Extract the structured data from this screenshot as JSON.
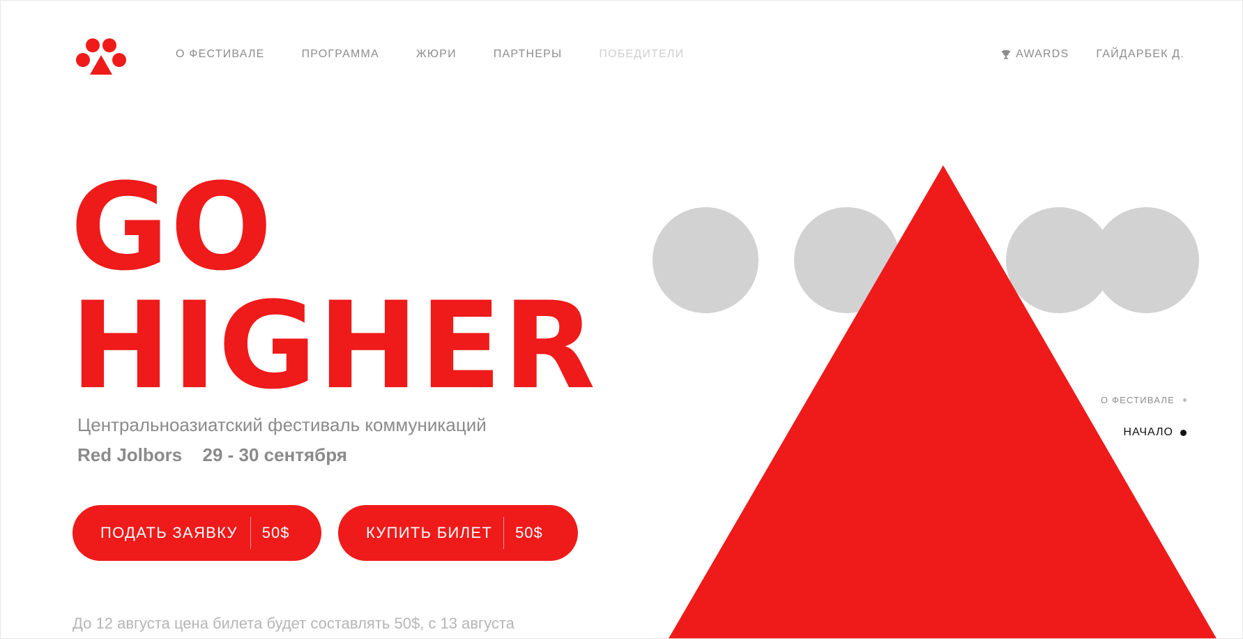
{
  "nav": {
    "items": [
      {
        "label": "О ФЕСТИВАЛЕ"
      },
      {
        "label": "ПРОГРАММА"
      },
      {
        "label": "ЖЮРИ"
      },
      {
        "label": "ПАРТНЕРЫ"
      },
      {
        "label": "ПОБЕДИТЕЛИ"
      }
    ],
    "awards_label": "AWARDS",
    "user_name": "ГАЙДАРБЕК Д."
  },
  "hero": {
    "title_line1": "GO",
    "title_line2": "HIGHER",
    "subtitle": "Центральноазиатский фестиваль коммуникаций",
    "festival_name": "Red Jolbors",
    "dates": "29 - 30 сентября",
    "note": "До 12 августа цена билета будет составлять 50$, с 13 августа"
  },
  "buttons": {
    "apply": {
      "label": "ПОДАТЬ ЗАЯВКУ",
      "price": "50$"
    },
    "ticket": {
      "label": "КУПИТЬ БИЛЕТ",
      "price": "50$"
    }
  },
  "side_nav": {
    "items": [
      {
        "label": "О ФЕСТИВАЛЕ",
        "active": false
      },
      {
        "label": "НАЧАЛО",
        "active": true
      }
    ]
  },
  "colors": {
    "brand_red": "#ef1a1a",
    "circle_grey": "#d2d2d2",
    "text_grey": "#8a8a8a",
    "muted_grey": "#cfcfcf"
  },
  "icons": {
    "logo": "paw-triangle-logo",
    "awards": "trophy-icon"
  }
}
